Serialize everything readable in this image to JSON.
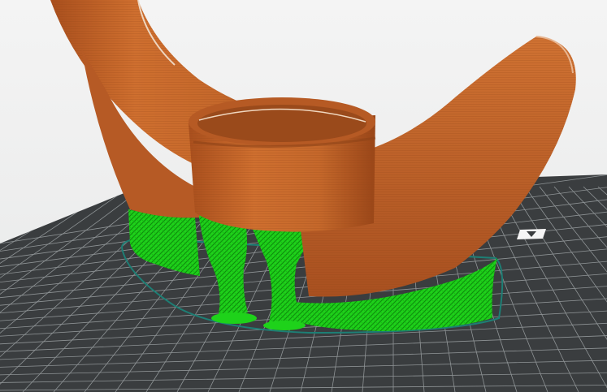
{
  "viewport": {
    "name": "3d-print-preview",
    "colors": {
      "background": "#f0f1f1",
      "build_plate": "#3a3d3f",
      "grid_line": "#8f9496",
      "model": "#c4662a",
      "model_shadow": "#8e4317",
      "support": "#1ccc18",
      "support_shadow": "#0e7f0d",
      "skirt": "#1d7f75"
    },
    "icons": [
      "build-plate-logo-icon"
    ]
  }
}
